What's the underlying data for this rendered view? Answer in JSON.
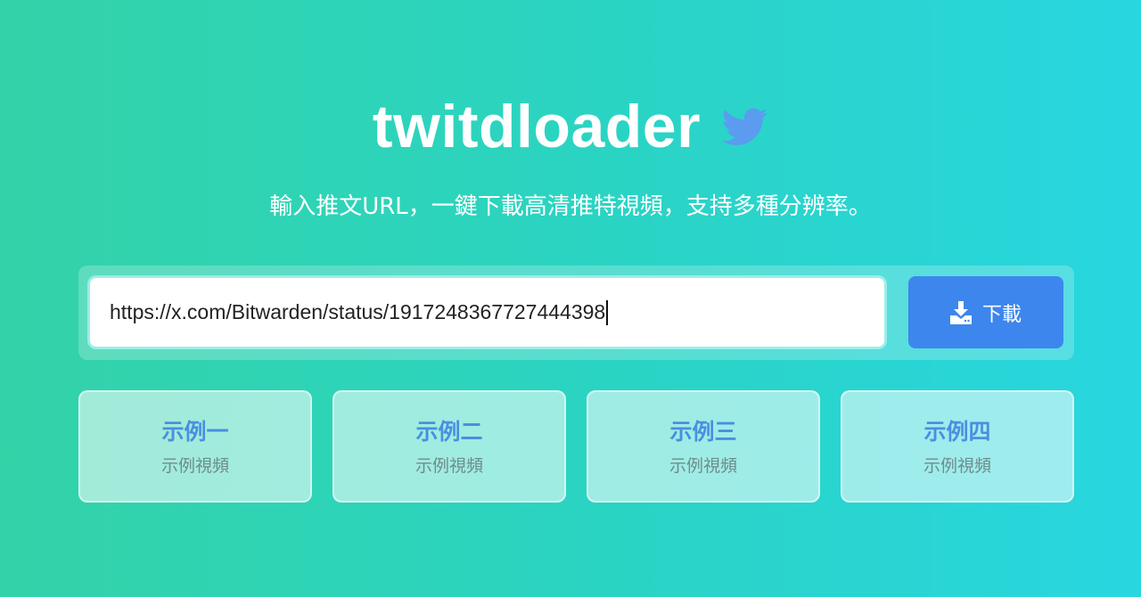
{
  "header": {
    "title": "twitdloader",
    "logo_icon": "twitter-bird-icon",
    "subtitle": "輸入推文URL，一鍵下載高清推特視頻，支持多種分辨率。"
  },
  "search": {
    "value": "https://x.com/Bitwarden/status/1917248367727444398",
    "download_label": "下載",
    "download_icon": "download-icon"
  },
  "examples": [
    {
      "title": "示例一",
      "subtitle": "示例視頻"
    },
    {
      "title": "示例二",
      "subtitle": "示例視頻"
    },
    {
      "title": "示例三",
      "subtitle": "示例視頻"
    },
    {
      "title": "示例四",
      "subtitle": "示例視頻"
    }
  ],
  "colors": {
    "background_start": "#33d3a8",
    "background_end": "#28d6e0",
    "button": "#3d86ee",
    "bird": "#5b9bf0",
    "card_title": "#4a8fe0"
  }
}
